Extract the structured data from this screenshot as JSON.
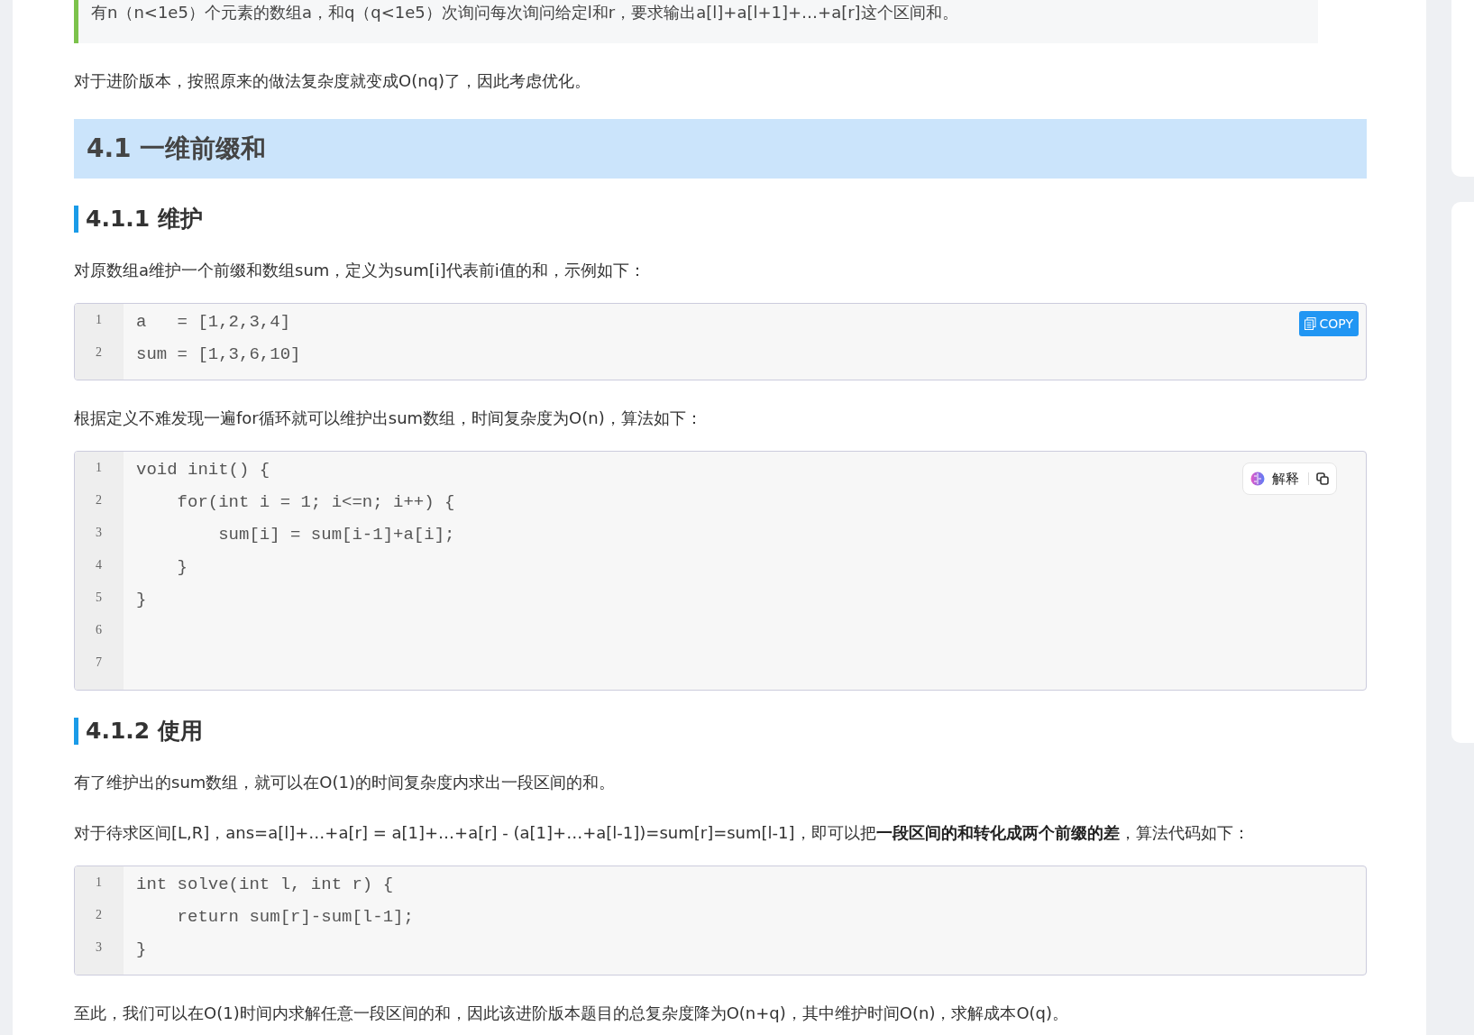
{
  "quote": "有n（n<1e5）个元素的数组a，和q（q<1e5）次询问每次询问给定l和r，要求输出a[l]+a[l+1]+…+a[r]这个区间和。",
  "blocks": [
    {
      "kind": "paragraph",
      "text": "对于进阶版本，按照原来的做法复杂度就变成O(nq)了，因此考虑优化。"
    },
    {
      "kind": "h2",
      "text": "4.1 一维前缀和"
    },
    {
      "kind": "h3",
      "text": "4.1.1 维护"
    },
    {
      "kind": "paragraph",
      "text": "对原数组a维护一个前缀和数组sum，定义为sum[i]代表前i值的和，示例如下："
    },
    {
      "kind": "code",
      "toolbar": {
        "kind": "copy",
        "label": "COPY"
      },
      "lines": [
        {
          "number": "1",
          "code": "a   = [1,2,3,4]"
        },
        {
          "number": "2",
          "code": "sum = [1,3,6,10]"
        }
      ]
    },
    {
      "kind": "paragraph",
      "text": "根据定义不难发现一遍for循环就可以维护出sum数组，时间复杂度为O(n)，算法如下："
    },
    {
      "kind": "code",
      "toolbar": {
        "kind": "explain",
        "label": "解释"
      },
      "lines": [
        {
          "number": "1",
          "code": "void init() {"
        },
        {
          "number": "2",
          "code": "    for(int i = 1; i<=n; i++) {"
        },
        {
          "number": "3",
          "code": "        sum[i] = sum[i-1]+a[i];"
        },
        {
          "number": "4",
          "code": "    }"
        },
        {
          "number": "5",
          "code": "}"
        },
        {
          "number": "6"
        },
        {
          "number": "7"
        }
      ]
    },
    {
      "kind": "h3",
      "text": "4.1.2 使用"
    },
    {
      "kind": "paragraph",
      "text": "有了维护出的sum数组，就可以在O(1)的时间复杂度内求出一段区间的和。"
    },
    {
      "kind": "paragraph",
      "text": "对于待求区间[L,R]，ans=a[l]+…+a[r] = a[1]+…+a[r] - (a[1]+…+a[l-1])=sum[r]=sum[l-1]，即可以把**一段区间的和转化成两个前缀的差**，算法代码如下："
    },
    {
      "kind": "code",
      "lines": [
        {
          "number": "1",
          "code": "int solve(int l, int r) {"
        },
        {
          "number": "2",
          "code": "    return sum[r]-sum[l-1];"
        },
        {
          "number": "3",
          "code": "}"
        }
      ]
    },
    {
      "kind": "paragraph",
      "text": "至此，我们可以在O(1)时间内求解任意一段区间的和，因此该进阶版本题目的总复杂度降为O(n+q)，其中维护时间O(n)，求解成本O(q)。"
    }
  ]
}
